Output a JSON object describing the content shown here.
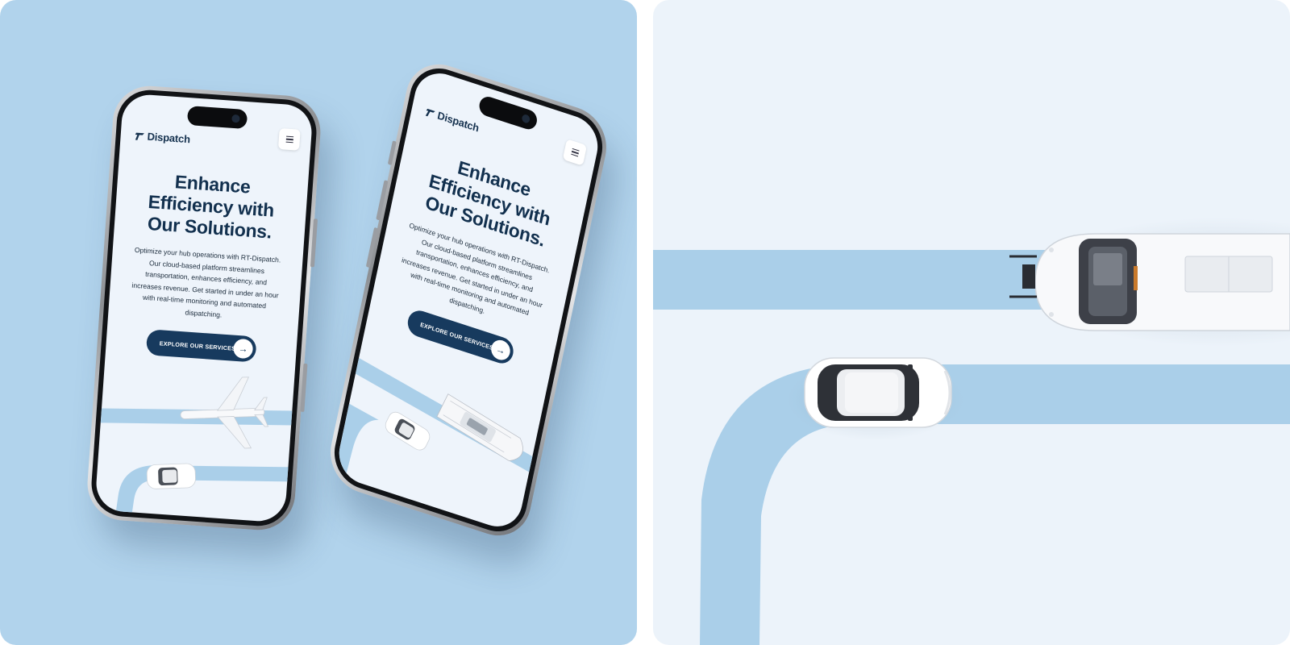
{
  "brand": {
    "name": "Dispatch"
  },
  "hero": {
    "headline_line1": "Enhance",
    "headline_line2": "Efficiency with",
    "headline_line3": "Our Solutions.",
    "body_line1": "Optimize your hub operations with RT-Dispatch.",
    "body_line2": "Our cloud-based platform streamlines",
    "body_line3": "transportation, enhances efficiency, and",
    "body_line4": "increases revenue. Get started in under an hour",
    "body_line5": "with real-time monitoring and automated",
    "body_line6": "dispatching.",
    "cta_label": "EXPLORE OUR SERVICES"
  },
  "icons": {
    "logo": "dispatch-logo-mark",
    "menu": "hamburger-menu-icon",
    "cta": "arrow-right-icon"
  },
  "colors": {
    "panel_left_bg": "#b1d3ec",
    "panel_right_bg": "#ecf3fa",
    "road": "#aacfe9",
    "heading": "#12304e",
    "cta_bg": "#173a5e"
  }
}
